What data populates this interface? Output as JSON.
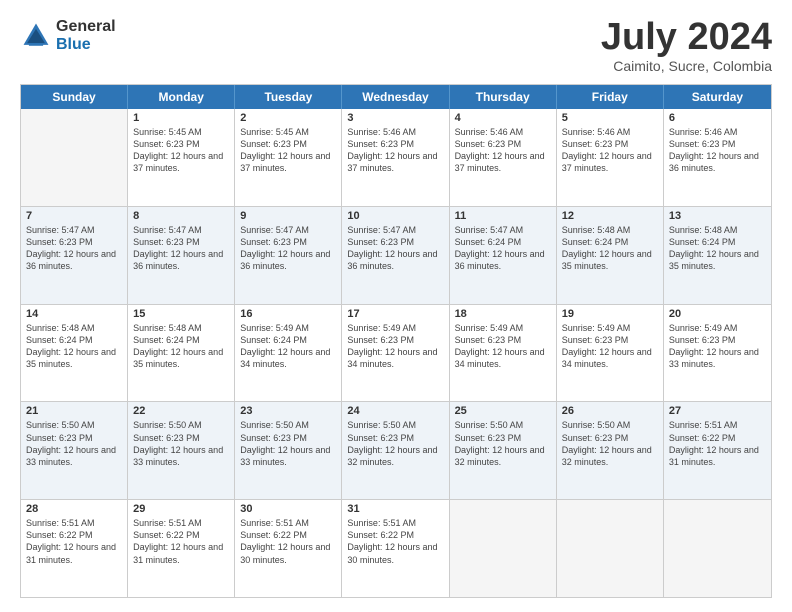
{
  "header": {
    "logo_general": "General",
    "logo_blue": "Blue",
    "month_title": "July 2024",
    "subtitle": "Caimito, Sucre, Colombia"
  },
  "weekdays": [
    "Sunday",
    "Monday",
    "Tuesday",
    "Wednesday",
    "Thursday",
    "Friday",
    "Saturday"
  ],
  "rows": [
    [
      {
        "day": "",
        "empty": true
      },
      {
        "day": "1",
        "sunrise": "Sunrise: 5:45 AM",
        "sunset": "Sunset: 6:23 PM",
        "daylight": "Daylight: 12 hours and 37 minutes."
      },
      {
        "day": "2",
        "sunrise": "Sunrise: 5:45 AM",
        "sunset": "Sunset: 6:23 PM",
        "daylight": "Daylight: 12 hours and 37 minutes."
      },
      {
        "day": "3",
        "sunrise": "Sunrise: 5:46 AM",
        "sunset": "Sunset: 6:23 PM",
        "daylight": "Daylight: 12 hours and 37 minutes."
      },
      {
        "day": "4",
        "sunrise": "Sunrise: 5:46 AM",
        "sunset": "Sunset: 6:23 PM",
        "daylight": "Daylight: 12 hours and 37 minutes."
      },
      {
        "day": "5",
        "sunrise": "Sunrise: 5:46 AM",
        "sunset": "Sunset: 6:23 PM",
        "daylight": "Daylight: 12 hours and 37 minutes."
      },
      {
        "day": "6",
        "sunrise": "Sunrise: 5:46 AM",
        "sunset": "Sunset: 6:23 PM",
        "daylight": "Daylight: 12 hours and 36 minutes."
      }
    ],
    [
      {
        "day": "7",
        "sunrise": "Sunrise: 5:47 AM",
        "sunset": "Sunset: 6:23 PM",
        "daylight": "Daylight: 12 hours and 36 minutes."
      },
      {
        "day": "8",
        "sunrise": "Sunrise: 5:47 AM",
        "sunset": "Sunset: 6:23 PM",
        "daylight": "Daylight: 12 hours and 36 minutes."
      },
      {
        "day": "9",
        "sunrise": "Sunrise: 5:47 AM",
        "sunset": "Sunset: 6:23 PM",
        "daylight": "Daylight: 12 hours and 36 minutes."
      },
      {
        "day": "10",
        "sunrise": "Sunrise: 5:47 AM",
        "sunset": "Sunset: 6:23 PM",
        "daylight": "Daylight: 12 hours and 36 minutes."
      },
      {
        "day": "11",
        "sunrise": "Sunrise: 5:47 AM",
        "sunset": "Sunset: 6:24 PM",
        "daylight": "Daylight: 12 hours and 36 minutes."
      },
      {
        "day": "12",
        "sunrise": "Sunrise: 5:48 AM",
        "sunset": "Sunset: 6:24 PM",
        "daylight": "Daylight: 12 hours and 35 minutes."
      },
      {
        "day": "13",
        "sunrise": "Sunrise: 5:48 AM",
        "sunset": "Sunset: 6:24 PM",
        "daylight": "Daylight: 12 hours and 35 minutes."
      }
    ],
    [
      {
        "day": "14",
        "sunrise": "Sunrise: 5:48 AM",
        "sunset": "Sunset: 6:24 PM",
        "daylight": "Daylight: 12 hours and 35 minutes."
      },
      {
        "day": "15",
        "sunrise": "Sunrise: 5:48 AM",
        "sunset": "Sunset: 6:24 PM",
        "daylight": "Daylight: 12 hours and 35 minutes."
      },
      {
        "day": "16",
        "sunrise": "Sunrise: 5:49 AM",
        "sunset": "Sunset: 6:24 PM",
        "daylight": "Daylight: 12 hours and 34 minutes."
      },
      {
        "day": "17",
        "sunrise": "Sunrise: 5:49 AM",
        "sunset": "Sunset: 6:23 PM",
        "daylight": "Daylight: 12 hours and 34 minutes."
      },
      {
        "day": "18",
        "sunrise": "Sunrise: 5:49 AM",
        "sunset": "Sunset: 6:23 PM",
        "daylight": "Daylight: 12 hours and 34 minutes."
      },
      {
        "day": "19",
        "sunrise": "Sunrise: 5:49 AM",
        "sunset": "Sunset: 6:23 PM",
        "daylight": "Daylight: 12 hours and 34 minutes."
      },
      {
        "day": "20",
        "sunrise": "Sunrise: 5:49 AM",
        "sunset": "Sunset: 6:23 PM",
        "daylight": "Daylight: 12 hours and 33 minutes."
      }
    ],
    [
      {
        "day": "21",
        "sunrise": "Sunrise: 5:50 AM",
        "sunset": "Sunset: 6:23 PM",
        "daylight": "Daylight: 12 hours and 33 minutes."
      },
      {
        "day": "22",
        "sunrise": "Sunrise: 5:50 AM",
        "sunset": "Sunset: 6:23 PM",
        "daylight": "Daylight: 12 hours and 33 minutes."
      },
      {
        "day": "23",
        "sunrise": "Sunrise: 5:50 AM",
        "sunset": "Sunset: 6:23 PM",
        "daylight": "Daylight: 12 hours and 33 minutes."
      },
      {
        "day": "24",
        "sunrise": "Sunrise: 5:50 AM",
        "sunset": "Sunset: 6:23 PM",
        "daylight": "Daylight: 12 hours and 32 minutes."
      },
      {
        "day": "25",
        "sunrise": "Sunrise: 5:50 AM",
        "sunset": "Sunset: 6:23 PM",
        "daylight": "Daylight: 12 hours and 32 minutes."
      },
      {
        "day": "26",
        "sunrise": "Sunrise: 5:50 AM",
        "sunset": "Sunset: 6:23 PM",
        "daylight": "Daylight: 12 hours and 32 minutes."
      },
      {
        "day": "27",
        "sunrise": "Sunrise: 5:51 AM",
        "sunset": "Sunset: 6:22 PM",
        "daylight": "Daylight: 12 hours and 31 minutes."
      }
    ],
    [
      {
        "day": "28",
        "sunrise": "Sunrise: 5:51 AM",
        "sunset": "Sunset: 6:22 PM",
        "daylight": "Daylight: 12 hours and 31 minutes."
      },
      {
        "day": "29",
        "sunrise": "Sunrise: 5:51 AM",
        "sunset": "Sunset: 6:22 PM",
        "daylight": "Daylight: 12 hours and 31 minutes."
      },
      {
        "day": "30",
        "sunrise": "Sunrise: 5:51 AM",
        "sunset": "Sunset: 6:22 PM",
        "daylight": "Daylight: 12 hours and 30 minutes."
      },
      {
        "day": "31",
        "sunrise": "Sunrise: 5:51 AM",
        "sunset": "Sunset: 6:22 PM",
        "daylight": "Daylight: 12 hours and 30 minutes."
      },
      {
        "day": "",
        "empty": true
      },
      {
        "day": "",
        "empty": true
      },
      {
        "day": "",
        "empty": true
      }
    ]
  ]
}
